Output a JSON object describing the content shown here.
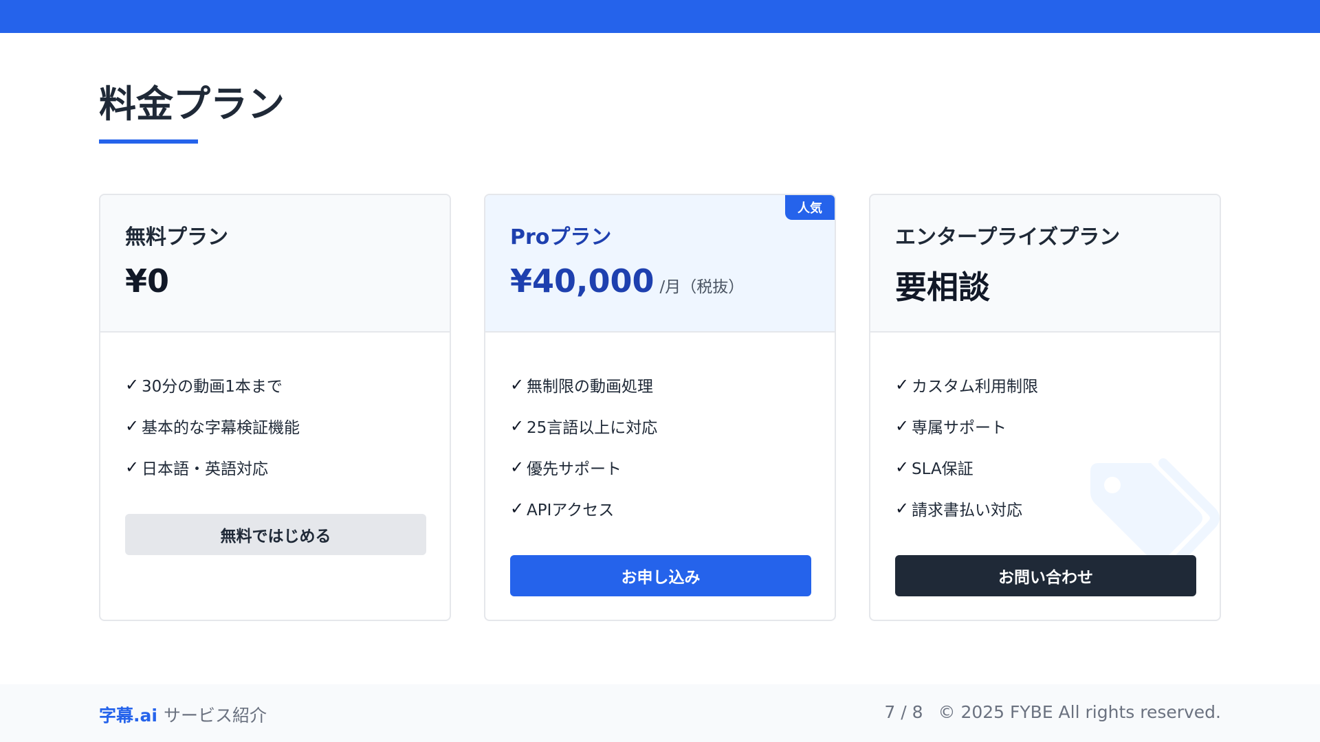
{
  "page": {
    "title": "料金プラン"
  },
  "plans": [
    {
      "name": "無料プラン",
      "price": "¥0",
      "features": [
        "30分の動画1本まで",
        "基本的な字幕検証機能",
        "日本語・英語対応"
      ],
      "cta": "無料ではじめる"
    },
    {
      "name": "Proプラン",
      "price": "¥40,000",
      "price_unit": "/月（税抜）",
      "badge": "人気",
      "features": [
        "無制限の動画処理",
        "25言語以上に対応",
        "優先サポート",
        "APIアクセス"
      ],
      "cta": "お申し込み"
    },
    {
      "name": "エンタープライズプラン",
      "price": "要相談",
      "features": [
        "カスタム利用制限",
        "専属サポート",
        "SLA保証",
        "請求書払い対応"
      ],
      "cta": "お問い合わせ"
    }
  ],
  "icons": {
    "check": "✓",
    "decorative": "tag-icon"
  },
  "footer": {
    "brand": "字幕.ai",
    "section": "サービス紹介",
    "page_indicator": "7 / 8",
    "copyright": "© 2025 FYBE All rights reserved."
  },
  "colors": {
    "accent": "#2563eb",
    "dark": "#1f2937",
    "pro_tint": "#eff6ff"
  }
}
